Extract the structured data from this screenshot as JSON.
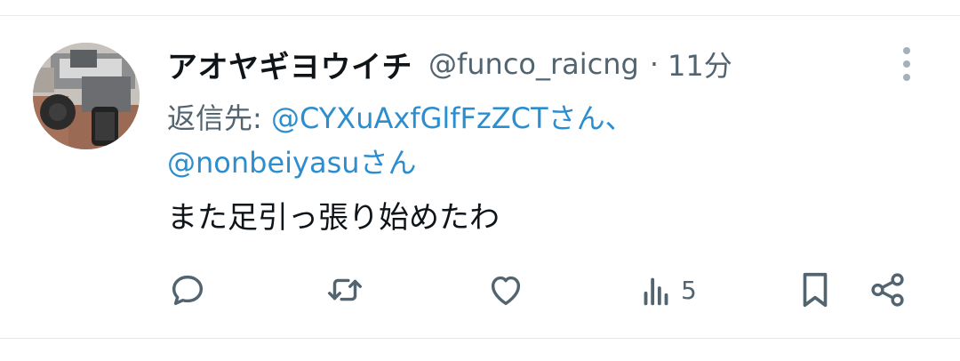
{
  "tweet": {
    "display_name": "アオヤギヨウイチ",
    "handle": "@funco_raicng",
    "separator": "·",
    "time": "11分",
    "reply_prefix": "返信先: ",
    "reply_mentions": [
      {
        "handle": "@CYXuAxfGlfFzZCT",
        "suffix": "さん、"
      },
      {
        "handle": "@nonbeiyasu",
        "suffix": "さん"
      }
    ],
    "text": "また足引っ張り始めたわ"
  },
  "actions": {
    "views_count": "5"
  },
  "icons": {
    "reply": "reply-icon",
    "retweet": "retweet-icon",
    "like": "heart-icon",
    "views": "views-icon",
    "bookmark": "bookmark-icon",
    "share": "share-icon",
    "more": "more-vertical-icon"
  },
  "colors": {
    "link": "#2d8ecf",
    "muted": "#536471",
    "text": "#0f1419"
  }
}
